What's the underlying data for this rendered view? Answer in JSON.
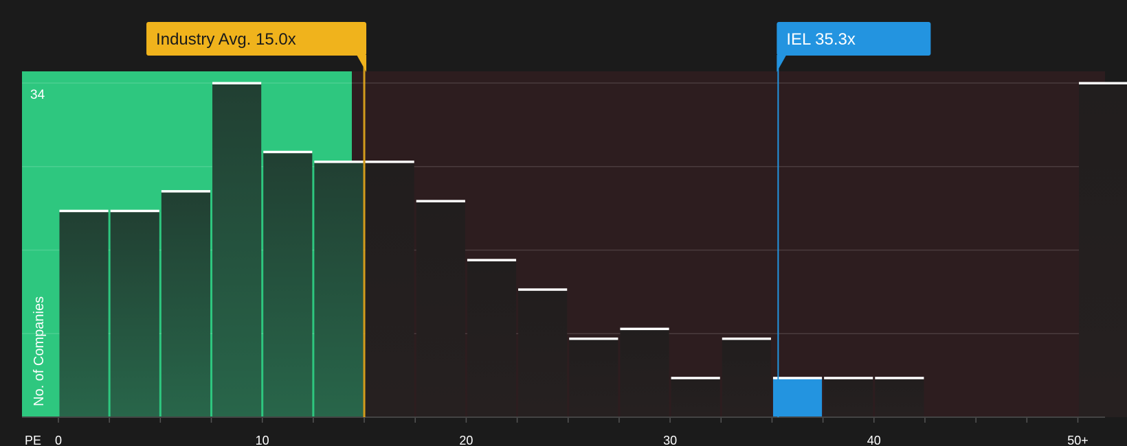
{
  "chart_data": {
    "type": "bar",
    "xlabel": "PE",
    "ylabel": "No. of Companies",
    "ylim": [
      0,
      34
    ],
    "y_max_label": "34",
    "x_ticks": [
      "0",
      "10",
      "20",
      "30",
      "40",
      "50+"
    ],
    "bins": [
      {
        "from": 0,
        "to": 2.5,
        "value": 21,
        "zone": "below"
      },
      {
        "from": 2.5,
        "to": 5,
        "value": 21,
        "zone": "below"
      },
      {
        "from": 5,
        "to": 7.5,
        "value": 23,
        "zone": "below"
      },
      {
        "from": 7.5,
        "to": 10,
        "value": 34,
        "zone": "below"
      },
      {
        "from": 10,
        "to": 12.5,
        "value": 27,
        "zone": "below"
      },
      {
        "from": 12.5,
        "to": 15,
        "value": 26,
        "zone": "below"
      },
      {
        "from": 15,
        "to": 17.5,
        "value": 26,
        "zone": "above"
      },
      {
        "from": 17.5,
        "to": 20,
        "value": 22,
        "zone": "above"
      },
      {
        "from": 20,
        "to": 22.5,
        "value": 16,
        "zone": "above"
      },
      {
        "from": 22.5,
        "to": 25,
        "value": 13,
        "zone": "above"
      },
      {
        "from": 25,
        "to": 27.5,
        "value": 8,
        "zone": "above"
      },
      {
        "from": 27.5,
        "to": 30,
        "value": 9,
        "zone": "above"
      },
      {
        "from": 30,
        "to": 32.5,
        "value": 4,
        "zone": "above"
      },
      {
        "from": 32.5,
        "to": 35,
        "value": 8,
        "zone": "above"
      },
      {
        "from": 35,
        "to": 37.5,
        "value": 4,
        "zone": "company"
      },
      {
        "from": 37.5,
        "to": 40,
        "value": 4,
        "zone": "above"
      },
      {
        "from": 40,
        "to": 42.5,
        "value": 4,
        "zone": "above"
      },
      {
        "from": 50,
        "to": 52.5,
        "value": 34,
        "zone": "above"
      }
    ],
    "markers": [
      {
        "label": "Industry Avg. 15.0x",
        "value": 15.0,
        "color": "#f0b31c"
      },
      {
        "label": "IEL 35.3x",
        "value": 35.3,
        "color": "#2394e0"
      }
    ],
    "grid": true,
    "colors": {
      "background": "#1b1b1b",
      "below_zone": "#2ec77f",
      "above_zone": "#2d1d1f",
      "company_bar": "#2394e0"
    }
  }
}
